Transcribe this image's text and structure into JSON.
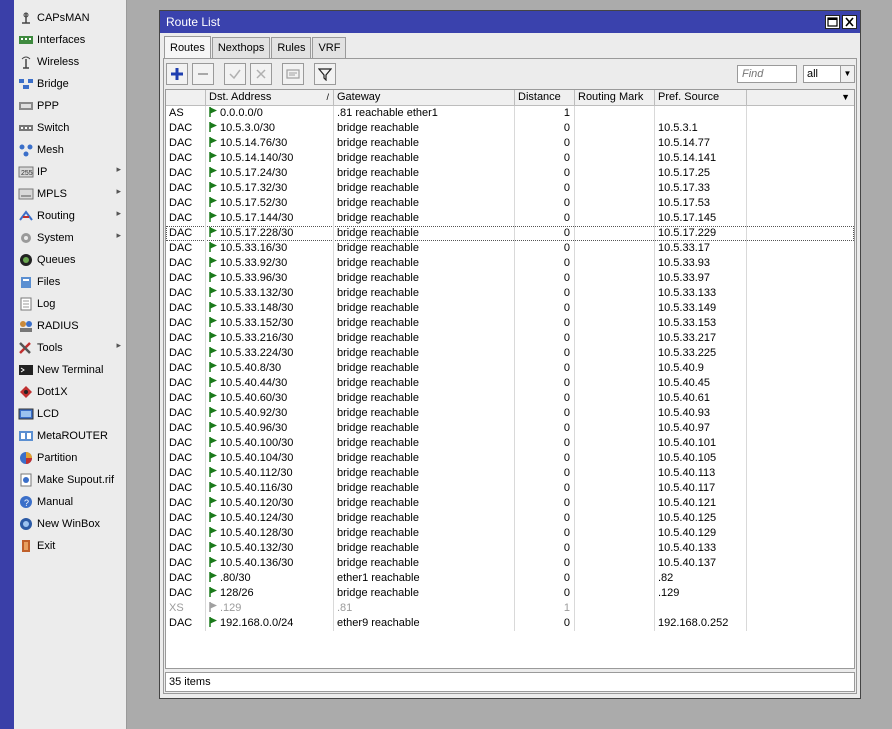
{
  "sidebar": {
    "items": [
      {
        "label": "CAPsMAN",
        "icon": "capsman-icon",
        "submenu": false
      },
      {
        "label": "Interfaces",
        "icon": "interfaces-icon",
        "submenu": false
      },
      {
        "label": "Wireless",
        "icon": "wireless-icon",
        "submenu": false
      },
      {
        "label": "Bridge",
        "icon": "bridge-icon",
        "submenu": false
      },
      {
        "label": "PPP",
        "icon": "ppp-icon",
        "submenu": false
      },
      {
        "label": "Switch",
        "icon": "switch-icon",
        "submenu": false
      },
      {
        "label": "Mesh",
        "icon": "mesh-icon",
        "submenu": false
      },
      {
        "label": "IP",
        "icon": "ip-icon",
        "submenu": true
      },
      {
        "label": "MPLS",
        "icon": "mpls-icon",
        "submenu": true
      },
      {
        "label": "Routing",
        "icon": "routing-icon",
        "submenu": true
      },
      {
        "label": "System",
        "icon": "system-icon",
        "submenu": true
      },
      {
        "label": "Queues",
        "icon": "queues-icon",
        "submenu": false
      },
      {
        "label": "Files",
        "icon": "files-icon",
        "submenu": false
      },
      {
        "label": "Log",
        "icon": "log-icon",
        "submenu": false
      },
      {
        "label": "RADIUS",
        "icon": "radius-icon",
        "submenu": false
      },
      {
        "label": "Tools",
        "icon": "tools-icon",
        "submenu": true
      },
      {
        "label": "New Terminal",
        "icon": "terminal-icon",
        "submenu": false
      },
      {
        "label": "Dot1X",
        "icon": "dot1x-icon",
        "submenu": false
      },
      {
        "label": "LCD",
        "icon": "lcd-icon",
        "submenu": false
      },
      {
        "label": "MetaROUTER",
        "icon": "metarouter-icon",
        "submenu": false
      },
      {
        "label": "Partition",
        "icon": "partition-icon",
        "submenu": false
      },
      {
        "label": "Make Supout.rif",
        "icon": "supout-icon",
        "submenu": false
      },
      {
        "label": "Manual",
        "icon": "manual-icon",
        "submenu": false
      },
      {
        "label": "New WinBox",
        "icon": "winbox-icon",
        "submenu": false
      },
      {
        "label": "Exit",
        "icon": "exit-icon",
        "submenu": false
      }
    ]
  },
  "window": {
    "title": "Route List",
    "tabs": [
      "Routes",
      "Nexthops",
      "Rules",
      "VRF"
    ],
    "active_tab": "Routes",
    "find_placeholder": "Find",
    "filter_value": "all",
    "columns": [
      "",
      "Dst. Address",
      "Gateway",
      "Distance",
      "Routing Mark",
      "Pref. Source"
    ],
    "rows": [
      {
        "flags": "AS",
        "dst": "0.0.0.0/0",
        "gw": ".81 reachable ether1",
        "dist": "1",
        "mark": "",
        "src": "",
        "flag": "green"
      },
      {
        "flags": "DAC",
        "dst": "10.5.3.0/30",
        "gw": "bridge reachable",
        "dist": "0",
        "mark": "",
        "src": "10.5.3.1",
        "flag": "green"
      },
      {
        "flags": "DAC",
        "dst": "10.5.14.76/30",
        "gw": "bridge reachable",
        "dist": "0",
        "mark": "",
        "src": "10.5.14.77",
        "flag": "green"
      },
      {
        "flags": "DAC",
        "dst": "10.5.14.140/30",
        "gw": "bridge reachable",
        "dist": "0",
        "mark": "",
        "src": "10.5.14.141",
        "flag": "green"
      },
      {
        "flags": "DAC",
        "dst": "10.5.17.24/30",
        "gw": "bridge reachable",
        "dist": "0",
        "mark": "",
        "src": "10.5.17.25",
        "flag": "green"
      },
      {
        "flags": "DAC",
        "dst": "10.5.17.32/30",
        "gw": "bridge reachable",
        "dist": "0",
        "mark": "",
        "src": "10.5.17.33",
        "flag": "green"
      },
      {
        "flags": "DAC",
        "dst": "10.5.17.52/30",
        "gw": "bridge reachable",
        "dist": "0",
        "mark": "",
        "src": "10.5.17.53",
        "flag": "green"
      },
      {
        "flags": "DAC",
        "dst": "10.5.17.144/30",
        "gw": "bridge reachable",
        "dist": "0",
        "mark": "",
        "src": "10.5.17.145",
        "flag": "green"
      },
      {
        "flags": "DAC",
        "dst": "10.5.17.228/30",
        "gw": "bridge reachable",
        "dist": "0",
        "mark": "",
        "src": "10.5.17.229",
        "flag": "green",
        "selected": true
      },
      {
        "flags": "DAC",
        "dst": "10.5.33.16/30",
        "gw": "bridge reachable",
        "dist": "0",
        "mark": "",
        "src": "10.5.33.17",
        "flag": "green"
      },
      {
        "flags": "DAC",
        "dst": "10.5.33.92/30",
        "gw": "bridge reachable",
        "dist": "0",
        "mark": "",
        "src": "10.5.33.93",
        "flag": "green"
      },
      {
        "flags": "DAC",
        "dst": "10.5.33.96/30",
        "gw": "bridge reachable",
        "dist": "0",
        "mark": "",
        "src": "10.5.33.97",
        "flag": "green"
      },
      {
        "flags": "DAC",
        "dst": "10.5.33.132/30",
        "gw": "bridge reachable",
        "dist": "0",
        "mark": "",
        "src": "10.5.33.133",
        "flag": "green"
      },
      {
        "flags": "DAC",
        "dst": "10.5.33.148/30",
        "gw": "bridge reachable",
        "dist": "0",
        "mark": "",
        "src": "10.5.33.149",
        "flag": "green"
      },
      {
        "flags": "DAC",
        "dst": "10.5.33.152/30",
        "gw": "bridge reachable",
        "dist": "0",
        "mark": "",
        "src": "10.5.33.153",
        "flag": "green"
      },
      {
        "flags": "DAC",
        "dst": "10.5.33.216/30",
        "gw": "bridge reachable",
        "dist": "0",
        "mark": "",
        "src": "10.5.33.217",
        "flag": "green"
      },
      {
        "flags": "DAC",
        "dst": "10.5.33.224/30",
        "gw": "bridge reachable",
        "dist": "0",
        "mark": "",
        "src": "10.5.33.225",
        "flag": "green"
      },
      {
        "flags": "DAC",
        "dst": "10.5.40.8/30",
        "gw": "bridge reachable",
        "dist": "0",
        "mark": "",
        "src": "10.5.40.9",
        "flag": "green"
      },
      {
        "flags": "DAC",
        "dst": "10.5.40.44/30",
        "gw": "bridge reachable",
        "dist": "0",
        "mark": "",
        "src": "10.5.40.45",
        "flag": "green"
      },
      {
        "flags": "DAC",
        "dst": "10.5.40.60/30",
        "gw": "bridge reachable",
        "dist": "0",
        "mark": "",
        "src": "10.5.40.61",
        "flag": "green"
      },
      {
        "flags": "DAC",
        "dst": "10.5.40.92/30",
        "gw": "bridge reachable",
        "dist": "0",
        "mark": "",
        "src": "10.5.40.93",
        "flag": "green"
      },
      {
        "flags": "DAC",
        "dst": "10.5.40.96/30",
        "gw": "bridge reachable",
        "dist": "0",
        "mark": "",
        "src": "10.5.40.97",
        "flag": "green"
      },
      {
        "flags": "DAC",
        "dst": "10.5.40.100/30",
        "gw": "bridge reachable",
        "dist": "0",
        "mark": "",
        "src": "10.5.40.101",
        "flag": "green"
      },
      {
        "flags": "DAC",
        "dst": "10.5.40.104/30",
        "gw": "bridge reachable",
        "dist": "0",
        "mark": "",
        "src": "10.5.40.105",
        "flag": "green"
      },
      {
        "flags": "DAC",
        "dst": "10.5.40.112/30",
        "gw": "bridge reachable",
        "dist": "0",
        "mark": "",
        "src": "10.5.40.113",
        "flag": "green"
      },
      {
        "flags": "DAC",
        "dst": "10.5.40.116/30",
        "gw": "bridge reachable",
        "dist": "0",
        "mark": "",
        "src": "10.5.40.117",
        "flag": "green"
      },
      {
        "flags": "DAC",
        "dst": "10.5.40.120/30",
        "gw": "bridge reachable",
        "dist": "0",
        "mark": "",
        "src": "10.5.40.121",
        "flag": "green"
      },
      {
        "flags": "DAC",
        "dst": "10.5.40.124/30",
        "gw": "bridge reachable",
        "dist": "0",
        "mark": "",
        "src": "10.5.40.125",
        "flag": "green"
      },
      {
        "flags": "DAC",
        "dst": "10.5.40.128/30",
        "gw": "bridge reachable",
        "dist": "0",
        "mark": "",
        "src": "10.5.40.129",
        "flag": "green"
      },
      {
        "flags": "DAC",
        "dst": "10.5.40.132/30",
        "gw": "bridge reachable",
        "dist": "0",
        "mark": "",
        "src": "10.5.40.133",
        "flag": "green"
      },
      {
        "flags": "DAC",
        "dst": "10.5.40.136/30",
        "gw": "bridge reachable",
        "dist": "0",
        "mark": "",
        "src": "10.5.40.137",
        "flag": "green"
      },
      {
        "flags": "DAC",
        "dst": ".80/30",
        "gw": "ether1 reachable",
        "dist": "0",
        "mark": "",
        "src": ".82",
        "flag": "green"
      },
      {
        "flags": "DAC",
        "dst": "128/26",
        "gw": "bridge reachable",
        "dist": "0",
        "mark": "",
        "src": ".129",
        "flag": "green"
      },
      {
        "flags": "XS",
        "dst": ".129",
        "gw": ".81",
        "dist": "1",
        "mark": "",
        "src": "",
        "flag": "gray",
        "dim": true
      },
      {
        "flags": "DAC",
        "dst": "192.168.0.0/24",
        "gw": "ether9 reachable",
        "dist": "0",
        "mark": "",
        "src": "192.168.0.252",
        "flag": "green"
      }
    ],
    "status": "35 items"
  },
  "colors": {
    "title_bar": "#3a42ad",
    "left_strip": "#3a3fa8",
    "flag_green": "#1a7a1a",
    "flag_gray": "#a0a0a0",
    "add_button": "#1f3fb0"
  }
}
